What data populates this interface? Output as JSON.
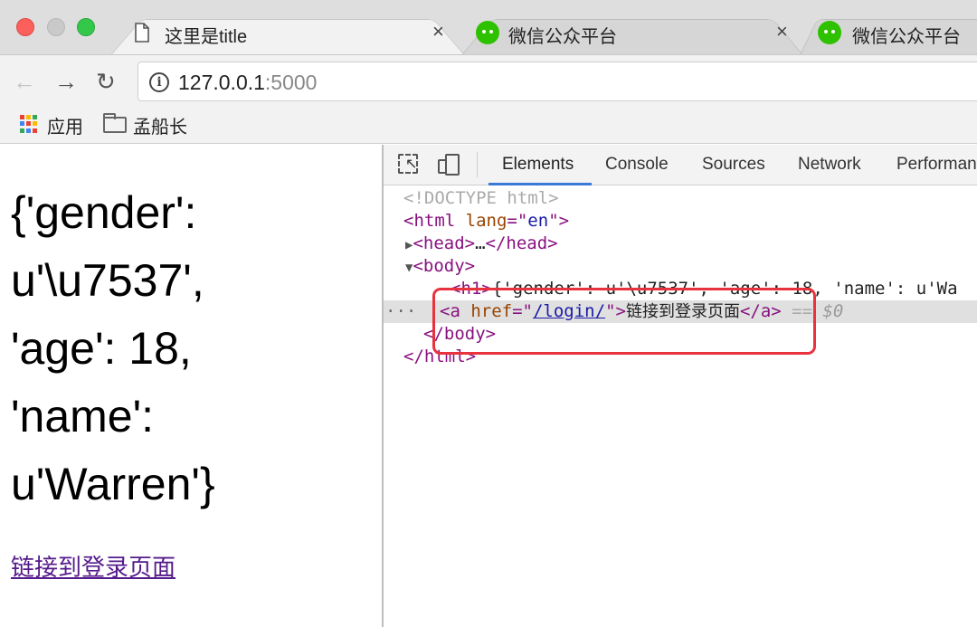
{
  "browser": {
    "tabs": [
      {
        "title": "这里是title",
        "close": "×",
        "icon": "document-icon"
      },
      {
        "title": "微信公众平台",
        "close": "×",
        "icon": "wechat-icon"
      },
      {
        "title": "微信公众平台",
        "icon": "wechat-icon"
      }
    ],
    "nav": {
      "back": "←",
      "forward": "→",
      "reload": "↻"
    },
    "address": {
      "host": "127.0.0.1",
      "port": ":5000",
      "info_icon": "i"
    },
    "bookmarks": [
      {
        "label": "应用",
        "icon": "apps-grid-icon"
      },
      {
        "label": "孟船长",
        "icon": "folder-icon"
      }
    ]
  },
  "page": {
    "heading_lines": [
      "{'gender':",
      "u'\\u7537',",
      "'age': 18,",
      "'name':",
      "u'Warren'}"
    ],
    "link_text": "链接到登录页面"
  },
  "devtools": {
    "tabs": [
      "Elements",
      "Console",
      "Sources",
      "Network",
      "Performan"
    ],
    "active_tab": "Elements",
    "code": {
      "doctype": "<!DOCTYPE html>",
      "html_open_tag": "<html",
      "html_attr": " lang",
      "html_eq": "=\"",
      "html_attr_val": "en",
      "html_close_bracket": "\">",
      "head_tag": "<head>",
      "ellipsis": "…",
      "head_close": "</head>",
      "body_open": "<body>",
      "h1_open": "<h1>",
      "h1_text": "{'gender': u'\\u7537', 'age': 18, 'name': u'Wa",
      "a_open": "<a",
      "a_attr": " href",
      "a_eq": "=\"",
      "a_href": "/login/",
      "a_quote_close": "\">",
      "a_text": "链接到登录页面",
      "a_close": "</a>",
      "selected_marker": " == ",
      "dollar0": "$0",
      "row_dots": "···",
      "body_close": "</body>",
      "html_close": "</html>",
      "tri_right": "▶",
      "tri_down": "▼"
    }
  },
  "colors": {
    "highlight_box": "#e8333e",
    "active_tab_underline": "#3879d9",
    "visited_link": "#551a8b"
  }
}
